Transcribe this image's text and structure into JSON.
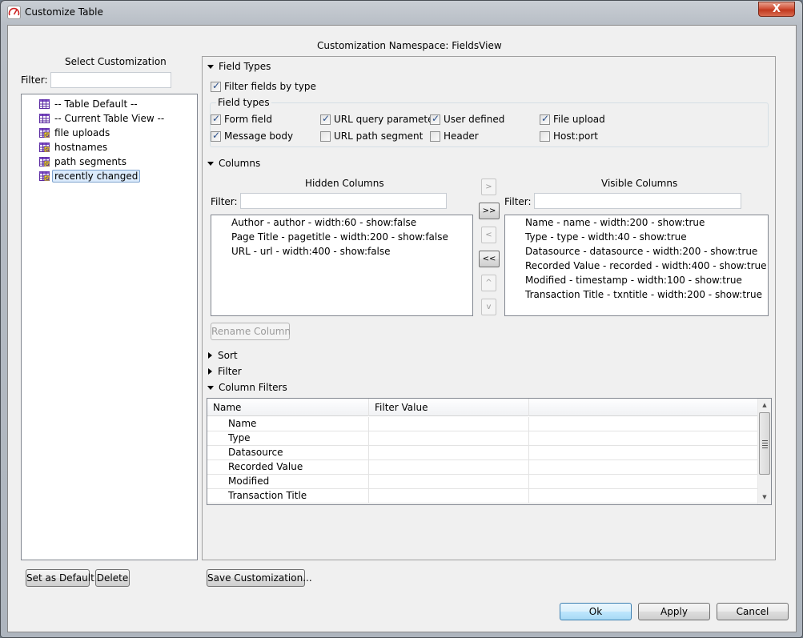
{
  "window": {
    "title": "Customize Table",
    "close_label": "X"
  },
  "namespace_label": "Customization Namespace: FieldsView",
  "left": {
    "heading": "Select Customization",
    "filter_label": "Filter:",
    "filter_value": "",
    "items": [
      {
        "label": "-- Table Default --",
        "icon": "table-icon",
        "selected": false
      },
      {
        "label": "-- Current Table View --",
        "icon": "table-icon",
        "selected": false
      },
      {
        "label": "file uploads",
        "icon": "table-global-icon",
        "selected": false
      },
      {
        "label": "hostnames",
        "icon": "table-global-icon",
        "selected": false
      },
      {
        "label": "path segments",
        "icon": "table-global-icon",
        "selected": false
      },
      {
        "label": "recently changed",
        "icon": "table-global-icon",
        "selected": true
      }
    ],
    "set_default_label": "Set as Default",
    "delete_label": "Delete"
  },
  "field_types": {
    "section_label": "Field Types",
    "expanded": true,
    "filter_by_type_label": "Filter fields by type",
    "filter_by_type_checked": true,
    "group_label": "Field types",
    "options": [
      {
        "label": "Form field",
        "checked": true
      },
      {
        "label": "URL query parameter",
        "checked": true
      },
      {
        "label": "User defined",
        "checked": true
      },
      {
        "label": "File upload",
        "checked": true
      },
      {
        "label": "Message body",
        "checked": true
      },
      {
        "label": "URL path segment",
        "checked": false
      },
      {
        "label": "Header",
        "checked": false
      },
      {
        "label": "Host:port",
        "checked": false
      }
    ]
  },
  "columns": {
    "section_label": "Columns",
    "expanded": true,
    "hidden": {
      "heading": "Hidden Columns",
      "filter_label": "Filter:",
      "filter_value": "",
      "items": [
        "Author - author - width:60 - show:false",
        "Page Title - pagetitle - width:200 - show:false",
        "URL - url - width:400 - show:false"
      ]
    },
    "visible": {
      "heading": "Visible Columns",
      "filter_label": "Filter:",
      "filter_value": "",
      "items": [
        "Name - name - width:200 - show:true",
        "Type - type - width:40 - show:true",
        "Datasource - datasource - width:200 - show:true",
        "Recorded Value - recorded - width:400 - show:true",
        "Modified - timestamp - width:100 - show:true",
        "Transaction Title - txntitle - width:200 - show:true"
      ]
    },
    "move_buttons": {
      "move_right": ">",
      "move_all_right": ">>",
      "move_left": "<",
      "move_all_left": "<<",
      "move_up": "^",
      "move_down": "v"
    },
    "rename_label": "Rename Column"
  },
  "sort": {
    "section_label": "Sort",
    "expanded": false
  },
  "filter": {
    "section_label": "Filter",
    "expanded": false
  },
  "column_filters": {
    "section_label": "Column Filters",
    "expanded": true,
    "headers": [
      "Name",
      "Filter Value",
      ""
    ],
    "rows": [
      {
        "name": "Name",
        "value": ""
      },
      {
        "name": "Type",
        "value": ""
      },
      {
        "name": "Datasource",
        "value": ""
      },
      {
        "name": "Recorded Value",
        "value": ""
      },
      {
        "name": "Modified",
        "value": ""
      },
      {
        "name": "Transaction Title",
        "value": ""
      }
    ]
  },
  "save_customization_label": "Save Customization...",
  "footer": {
    "ok_label": "Ok",
    "apply_label": "Apply",
    "cancel_label": "Cancel"
  }
}
